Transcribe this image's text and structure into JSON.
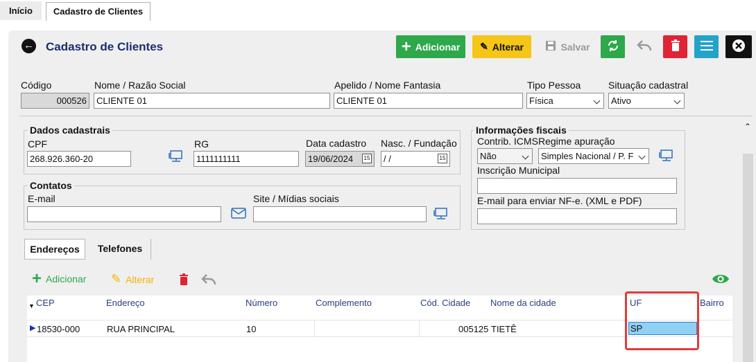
{
  "tabs": {
    "home": "Início",
    "active": "Cadastro de Clientes"
  },
  "header": {
    "title": "Cadastro de Clientes"
  },
  "toolbar": {
    "add_label": "Adicionar",
    "edit_label": "Alterar",
    "save_label": "Salvar"
  },
  "form": {
    "codigo_label": "Código",
    "codigo_value": "000526",
    "nome_label": "Nome / Razão Social",
    "nome_value": "CLIENTE 01",
    "apelido_label": "Apelido / Nome Fantasia",
    "apelido_value": "CLIENTE 01",
    "tipo_label": "Tipo Pessoa",
    "tipo_value": "Física",
    "situacao_label": "Situação cadastral",
    "situacao_value": "Ativo"
  },
  "dados": {
    "title": "Dados cadastrais",
    "cpf_label": "CPF",
    "cpf_value": "268.926.360-20",
    "rg_label": "RG",
    "rg_value": "1111111111",
    "data_label": "Data cadastro",
    "data_value": "19/06/2024",
    "nasc_label": "Nasc. / Fundação",
    "nasc_value": " / /"
  },
  "contatos": {
    "title": "Contatos",
    "email_label": "E-mail",
    "email_value": "",
    "site_label": "Site / Mídias sociais",
    "site_value": ""
  },
  "fiscais": {
    "title": "Informações fiscais",
    "icms_label": "Contrib. ICMS",
    "icms_value": "Não",
    "regime_label": "Regime apuração",
    "regime_value": "Simples Nacional / P. F",
    "im_label": "Inscrição Municipal",
    "im_value": "",
    "nfe_label": "E-mail para enviar NF-e. (XML e PDF)",
    "nfe_value": ""
  },
  "subtabs": {
    "enderecos": "Endereços",
    "telefones": "Telefones"
  },
  "grid_toolbar": {
    "add_label": "Adicionar",
    "edit_label": "Alterar"
  },
  "grid": {
    "columns": [
      "CEP",
      "Endereço",
      "Número",
      "Complemento",
      "Cód. Cidade",
      "Nome da cidade",
      "UF",
      "Bairro"
    ],
    "rows": [
      {
        "cep": "18530-000",
        "endereco": "RUA PRINCIPAL",
        "numero": "10",
        "complemento": "",
        "cod_cidade": "005125",
        "cidade": "TIETÊ",
        "uf": "SP",
        "bairro": ""
      }
    ]
  },
  "colors": {
    "green": "#2ea84a",
    "yellow": "#f5c518",
    "red": "#e02434",
    "cyan": "#23a3c8",
    "title": "#1a2f6e",
    "highlight": "#e23b3b"
  }
}
